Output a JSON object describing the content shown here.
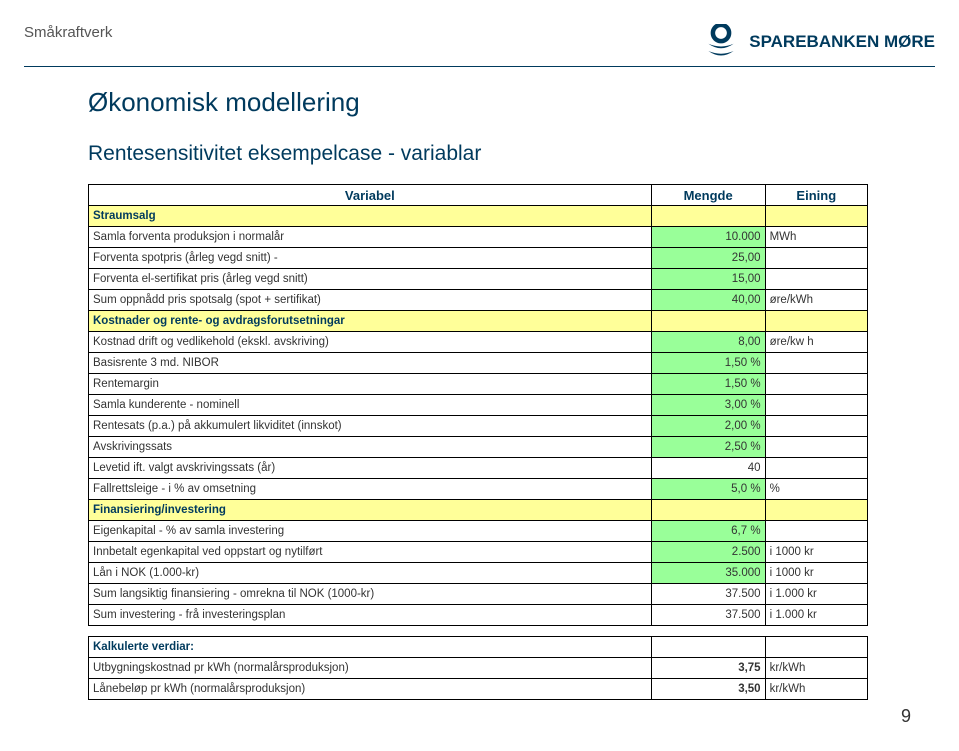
{
  "doc_title": "Småkraftverk",
  "brand_name": "SPAREBANKEN MØRE",
  "page_number": "9",
  "h1": "Økonomisk modellering",
  "h2": "Rentesensitivitet eksempelcase - variablar",
  "headers": {
    "variable": "Variabel",
    "amount": "Mengde",
    "unit": "Eining"
  },
  "sections": {
    "straumsalg": "Straumsalg",
    "kostnader": "Kostnader og rente- og avdragsforutsetningar",
    "finans": "Finansiering/investering",
    "kalkulerte": "Kalkulerte verdiar:"
  },
  "rows": [
    {
      "label": "Samla forventa produksjon i normalår",
      "val": "10.000",
      "unit": "MWh"
    },
    {
      "label": "Forventa spotpris (årleg vegd snitt) -",
      "val": "25,00",
      "unit": ""
    },
    {
      "label": "Forventa el-sertifikat pris (årleg vegd snitt)",
      "val": "15,00",
      "unit": ""
    },
    {
      "label": "Sum oppnådd pris spotsalg (spot + sertifikat)",
      "val": "40,00",
      "unit": "øre/kWh"
    },
    {
      "label": "Kostnad drift og vedlikehold (ekskl. avskriving)",
      "val": "8,00",
      "unit": "øre/kw h"
    },
    {
      "label": "Basisrente 3 md. NIBOR",
      "val": "1,50 %",
      "unit": ""
    },
    {
      "label": "Rentemargin",
      "val": "1,50 %",
      "unit": ""
    },
    {
      "label": "Samla kunderente - nominell",
      "val": "3,00 %",
      "unit": ""
    },
    {
      "label": "Rentesats (p.a.) på akkumulert likviditet (innskot)",
      "val": "2,00 %",
      "unit": ""
    },
    {
      "label": "Avskrivingssats",
      "val": "2,50 %",
      "unit": ""
    },
    {
      "label": "Levetid ift. valgt avskrivingssats (år)",
      "val": "40",
      "unit": ""
    },
    {
      "label": "Fallrettsleige - i % av omsetning",
      "val": "5,0 %",
      "unit": "%"
    },
    {
      "label": "Eigenkapital - % av samla investering",
      "val": "6,7 %",
      "unit": ""
    },
    {
      "label": "Innbetalt egenkapital ved oppstart og nytilført",
      "val": "2.500",
      "unit": "i 1000 kr"
    },
    {
      "label": "Lån i NOK (1.000-kr)",
      "val": "35.000",
      "unit": "i 1000 kr"
    },
    {
      "label": "Sum langsiktig finansiering - omrekna til NOK (1000-kr)",
      "val": "37.500",
      "unit": "i 1.000 kr"
    },
    {
      "label": "Sum investering - frå investeringsplan",
      "val": "37.500",
      "unit": "i 1.000 kr"
    }
  ],
  "calc_rows": [
    {
      "label": "Utbygningskostnad pr kWh (normalårsproduksjon)",
      "val": "3,75",
      "unit": "kr/kWh"
    },
    {
      "label": "Lånebeløp pr kWh (normalårsproduksjon)",
      "val": "3,50",
      "unit": "kr/kWh"
    }
  ],
  "chart_data": {
    "type": "table",
    "title": "Rentesensitivitet eksempelcase - variablar",
    "columns": [
      "Variabel",
      "Mengde",
      "Eining"
    ],
    "sections": [
      {
        "name": "Straumsalg",
        "rows": [
          [
            "Samla forventa produksjon i normalår",
            10000,
            "MWh"
          ],
          [
            "Forventa spotpris (årleg vegd snitt)",
            25.0,
            ""
          ],
          [
            "Forventa el-sertifikat pris (årleg vegd snitt)",
            15.0,
            ""
          ],
          [
            "Sum oppnådd pris spotsalg (spot + sertifikat)",
            40.0,
            "øre/kWh"
          ]
        ]
      },
      {
        "name": "Kostnader og rente- og avdragsforutsetningar",
        "rows": [
          [
            "Kostnad drift og vedlikehold (ekskl. avskriving)",
            8.0,
            "øre/kw h"
          ],
          [
            "Basisrente 3 md. NIBOR",
            "1,50 %",
            ""
          ],
          [
            "Rentemargin",
            "1,50 %",
            ""
          ],
          [
            "Samla kunderente - nominell",
            "3,00 %",
            ""
          ],
          [
            "Rentesats (p.a.) på akkumulert likviditet (innskot)",
            "2,00 %",
            ""
          ],
          [
            "Avskrivingssats",
            "2,50 %",
            ""
          ],
          [
            "Levetid ift. valgt avskrivingssats (år)",
            40,
            ""
          ],
          [
            "Fallrettsleige - i % av omsetning",
            "5,0 %",
            "%"
          ]
        ]
      },
      {
        "name": "Finansiering/investering",
        "rows": [
          [
            "Eigenkapital - % av samla investering",
            "6,7 %",
            ""
          ],
          [
            "Innbetalt egenkapital ved oppstart og nytilført",
            2500,
            "i 1000 kr"
          ],
          [
            "Lån i NOK (1.000-kr)",
            35000,
            "i 1000 kr"
          ],
          [
            "Sum langsiktig finansiering - omrekna til NOK (1000-kr)",
            37500,
            "i 1.000 kr"
          ],
          [
            "Sum investering - frå investeringsplan",
            37500,
            "i 1.000 kr"
          ]
        ]
      },
      {
        "name": "Kalkulerte verdiar:",
        "rows": [
          [
            "Utbygningskostnad pr kWh (normalårsproduksjon)",
            3.75,
            "kr/kWh"
          ],
          [
            "Lånebeløp pr kWh (normalårsproduksjon)",
            3.5,
            "kr/kWh"
          ]
        ]
      }
    ]
  }
}
